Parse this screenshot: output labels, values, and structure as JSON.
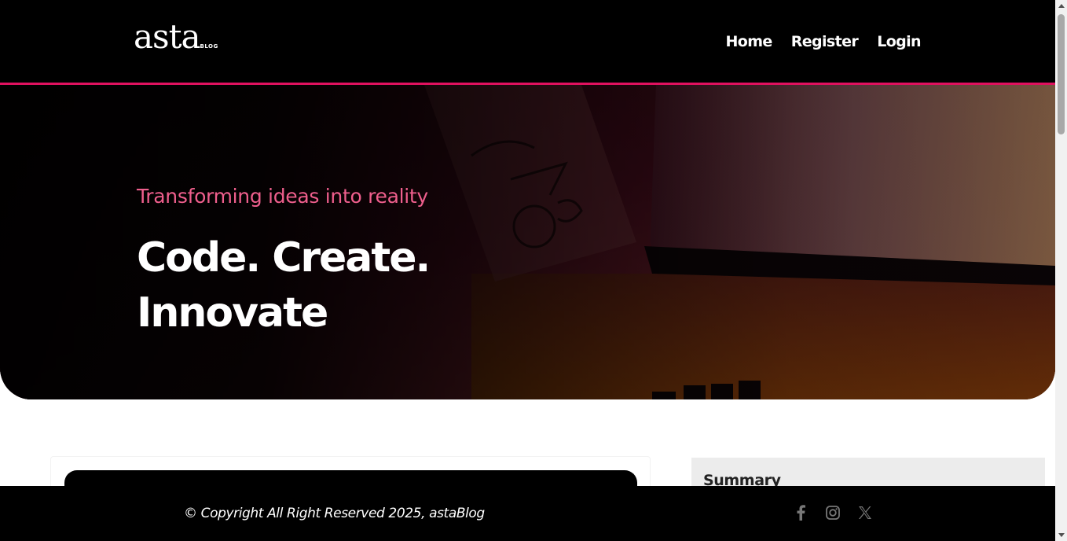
{
  "header": {
    "logo_text": "asta",
    "logo_suffix": "BLOG",
    "nav": [
      {
        "label": "Home"
      },
      {
        "label": "Register"
      },
      {
        "label": "Login"
      }
    ]
  },
  "hero": {
    "tagline": "Transforming ideas into reality",
    "title": "Code. Create. Innovate"
  },
  "sidebar": {
    "summary_title": "Summary"
  },
  "footer": {
    "copyright": "© Copyright All Right Reserved 2025, astaBlog",
    "social_icons": [
      "facebook-icon",
      "instagram-icon",
      "x-icon"
    ]
  },
  "colors": {
    "accent": "#e0115f",
    "tagline": "#ef5f8d",
    "header_bg": "#000000",
    "summary_bg": "#ececec"
  }
}
